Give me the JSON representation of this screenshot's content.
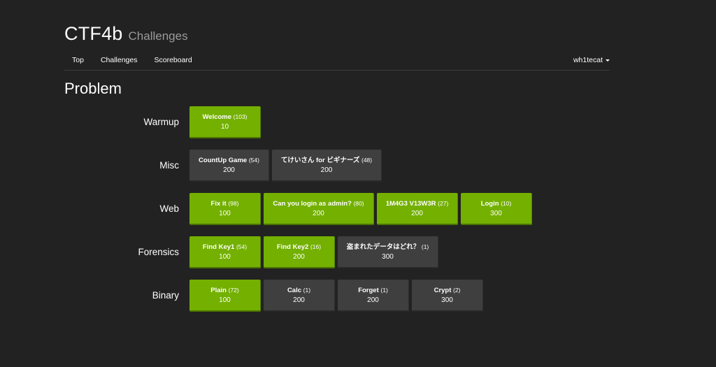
{
  "header": {
    "brand": "CTF4b",
    "subtitle": "Challenges"
  },
  "nav": {
    "items": [
      {
        "label": "Top"
      },
      {
        "label": "Challenges"
      },
      {
        "label": "Scoreboard"
      }
    ],
    "user": "wh1tecat"
  },
  "page_title": "Problem",
  "colors": {
    "background": "#222222",
    "solved": "#73b000",
    "unsolved": "#3f3f3f"
  },
  "categories": [
    {
      "name": "Warmup",
      "challenges": [
        {
          "title": "Welcome",
          "count": "(103)",
          "points": "10",
          "solved": true
        }
      ]
    },
    {
      "name": "Misc",
      "challenges": [
        {
          "title": "CountUp Game",
          "count": "(54)",
          "points": "200",
          "solved": false
        },
        {
          "title": "てけいさん for ビギナーズ",
          "count": "(48)",
          "points": "200",
          "solved": false
        }
      ]
    },
    {
      "name": "Web",
      "challenges": [
        {
          "title": "Fix it",
          "count": "(98)",
          "points": "100",
          "solved": true
        },
        {
          "title": "Can you login as admin?",
          "count": "(80)",
          "points": "200",
          "solved": true
        },
        {
          "title": "1M4G3 V13W3R",
          "count": "(27)",
          "points": "200",
          "solved": true
        },
        {
          "title": "Login",
          "count": "(10)",
          "points": "300",
          "solved": true
        }
      ]
    },
    {
      "name": "Forensics",
      "challenges": [
        {
          "title": "Find Key1",
          "count": "(54)",
          "points": "100",
          "solved": true
        },
        {
          "title": "Find Key2",
          "count": "(16)",
          "points": "200",
          "solved": true
        },
        {
          "title": "盗まれたデータはどれ？",
          "count": "(1)",
          "points": "300",
          "solved": false
        }
      ]
    },
    {
      "name": "Binary",
      "challenges": [
        {
          "title": "Plain",
          "count": "(72)",
          "points": "100",
          "solved": true
        },
        {
          "title": "Calc",
          "count": "(1)",
          "points": "200",
          "solved": false
        },
        {
          "title": "Forget",
          "count": "(1)",
          "points": "200",
          "solved": false
        },
        {
          "title": "Crypt",
          "count": "(2)",
          "points": "300",
          "solved": false
        }
      ]
    }
  ]
}
